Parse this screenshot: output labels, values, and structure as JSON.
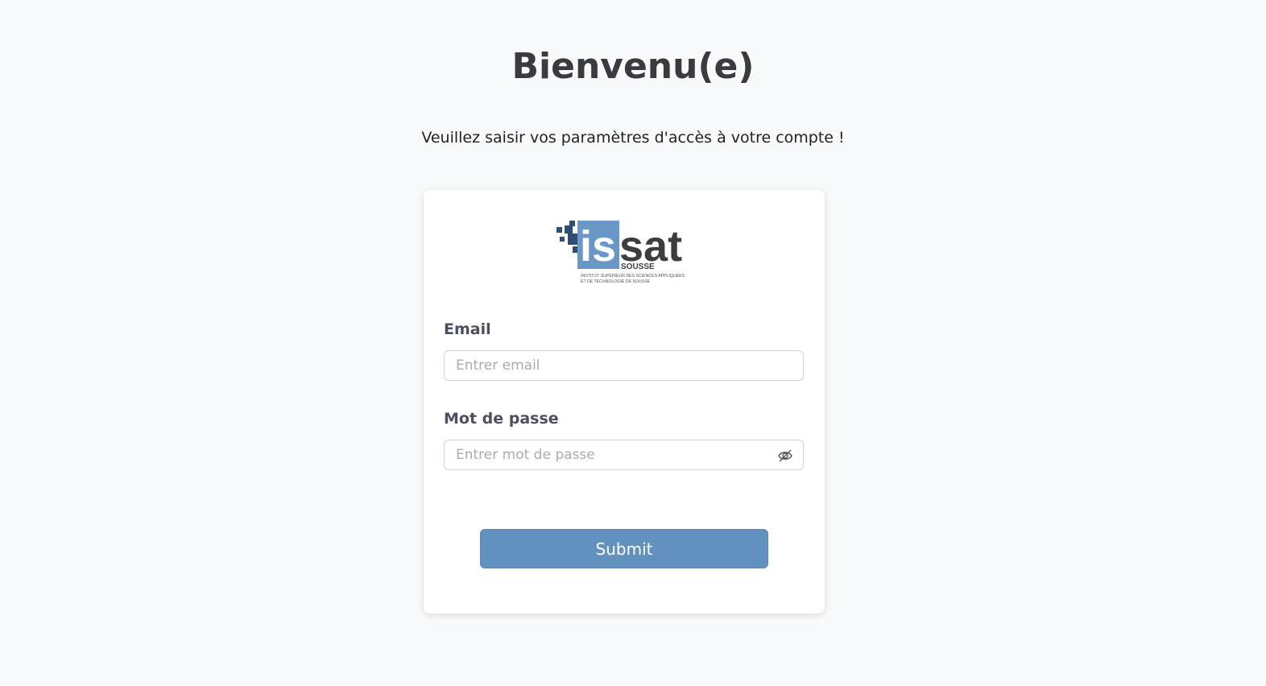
{
  "header": {
    "title": "Bienvenu(e)",
    "subtitle": "Veuillez saisir vos paramètres d'accès à votre compte !"
  },
  "logo": {
    "icon": "issat-sousse-logo",
    "wordmark_left": "is",
    "wordmark_right": "sat",
    "city": "SOUSSE",
    "tagline_line1": "INSTITUT SUPÉRIEUR DES SCIENCES APPLIQUÉES",
    "tagline_line2": "ET DE TECHNOLOGIE DE SOUSSE",
    "colors": {
      "blue": "#6a98c6",
      "dark": "#3d3d3d",
      "squares": "#2e4e76"
    }
  },
  "form": {
    "email_label": "Email",
    "email_placeholder": "Entrer email",
    "email_value": "",
    "password_label": "Mot de passe",
    "password_placeholder": "Entrer mot de passe",
    "password_value": "",
    "password_toggle_icon": "eye-slash-icon",
    "submit_label": "Submit"
  },
  "colors": {
    "background": "#f8f9fa",
    "card": "#ffffff",
    "button": "#6192bf",
    "title": "#3a3a40",
    "label": "#4a5061"
  }
}
